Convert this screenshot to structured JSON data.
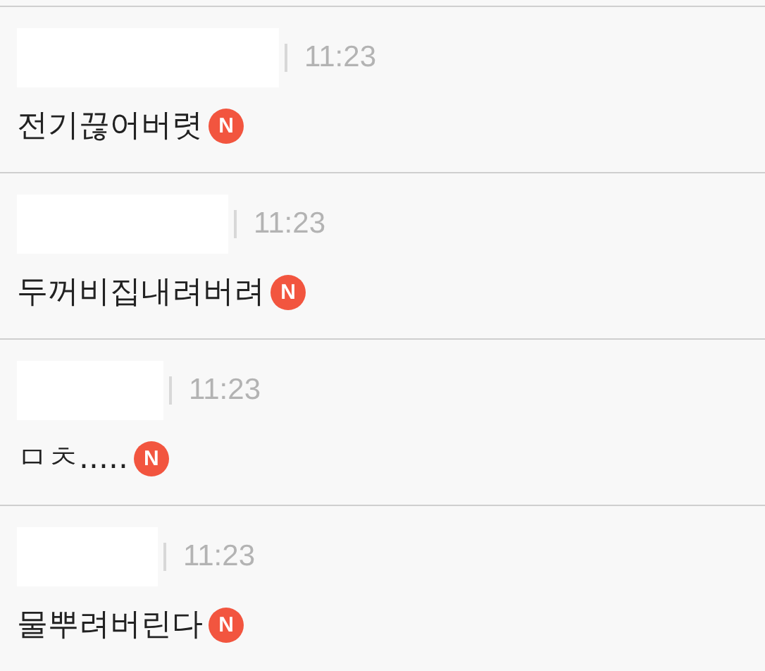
{
  "comments": [
    {
      "time": "11:23",
      "text": "전기끊어버렷",
      "badge": "N"
    },
    {
      "time": "11:23",
      "text": "두꺼비집내려버려",
      "badge": "N"
    },
    {
      "time": "11:23",
      "text": "ㅁㅊ.....",
      "badge": "N"
    },
    {
      "time": "11:23",
      "text": "물뿌려버린다",
      "badge": "N"
    }
  ]
}
